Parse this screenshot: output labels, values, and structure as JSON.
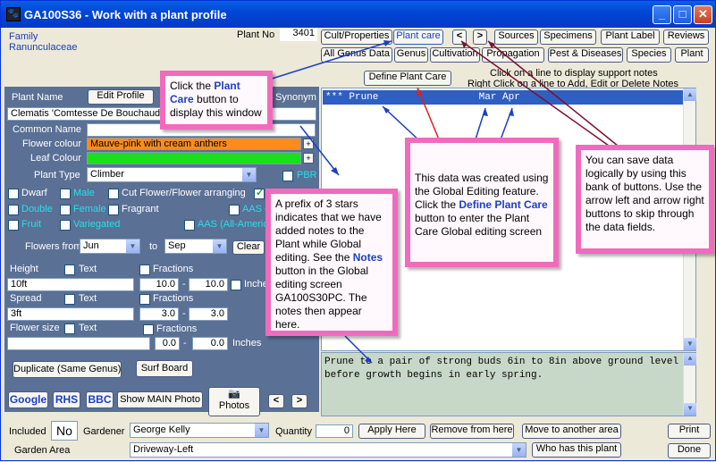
{
  "window": {
    "title": "GA100S36 - Work with a plant profile",
    "minimize": "_",
    "maximize": "□",
    "close": "✕",
    "app_icon": "🐾"
  },
  "header": {
    "family_label": "Family",
    "family_value": "Ranunculaceae",
    "plant_no_label": "Plant No",
    "plant_no_value": "3401"
  },
  "tabs_row1": [
    "Cult/Properties",
    "Plant care",
    "Sources",
    "Specimens",
    "Plant Label",
    "Reviews"
  ],
  "tabs_row2": [
    "All Genus Data",
    "Genus",
    "Cultivation",
    "Propagation",
    "Pest & Diseases",
    "Species",
    "Plant"
  ],
  "nav": {
    "left": "<",
    "right": ">"
  },
  "define_button": "Define Plant Care",
  "hints": {
    "line1": "Click on a line to display support notes",
    "line2": "Right Click on a line to Add, Edit or Delete Notes"
  },
  "notes": {
    "row_text": "*** Prune                 Mar Apr",
    "detail": "Prune to a pair of strong buds 6in to 8in above ground level before growth begins in early spring."
  },
  "form": {
    "plant_name_label": "Plant Name",
    "edit_profile": "Edit Profile",
    "synonym": "Synonym",
    "plant_name_value": "Clematis 'Comtesse De Bouchaud'",
    "common_name_label": "Common Name",
    "common_name_value": "",
    "flower_colour_label": "Flower colour",
    "flower_colour_value": "Mauve-pink with cream anthers",
    "leaf_colour_label": "Leaf Colour",
    "leaf_colour_value": "",
    "plant_type_label": "Plant Type",
    "plant_type_value": "Climber",
    "pbr": "PBR",
    "checks": [
      "Dwarf",
      "Male",
      "Cut Flower/Flower arranging",
      "A",
      "Double",
      "Female",
      "Fragrant",
      "AAS G",
      "Fruit",
      "Variegated",
      "AAS (All-America"
    ],
    "flowers_from_label": "Flowers from",
    "flowers_from_value": "Jun",
    "to_label": "to",
    "flowers_to_value": "Sep",
    "clear": "Clear",
    "height_label": "Height",
    "text_label": "Text",
    "fractions_label": "Fractions",
    "height_value": "10ft",
    "height_min": "10.0",
    "height_max": "10.0",
    "inches": "Inches",
    "spread_label": "Spread",
    "spread_value": "3ft",
    "spread_min": "3.0",
    "spread_max": "3.0",
    "flower_size_label": "Flower size",
    "flower_size_value": "",
    "fs_min": "0.0",
    "fs_max": "0.0",
    "dash": "-",
    "duplicate": "Duplicate (Same Genus)",
    "surf_board": "Surf Board",
    "google": "Google",
    "rhs": "RHS",
    "bbc": "BBC",
    "show_main_photo": "Show MAIN Photo",
    "photos": "Photos",
    "camera_icon": "📷"
  },
  "footer": {
    "included_label": "Included",
    "included_value": "No",
    "gardener_label": "Gardener",
    "gardener_value": "George Kelly",
    "quantity_label": "Quantity",
    "quantity_value": "0",
    "apply_here": "Apply Here",
    "remove_from_here": "Remove from here",
    "move_to_another_area": "Move to another area",
    "print": "Print",
    "garden_area_label": "Garden Area",
    "garden_area_value": "Driveway-Left",
    "who_has": "Who has this plant",
    "done": "Done"
  },
  "callouts": {
    "c1_pre": "Click the ",
    "c1_bold": "Plant Care",
    "c1_post": " button to display this window",
    "c2_pre": "A prefix of 3 stars indicates that we have added notes to the Plant while Global editing. See the ",
    "c2_bold": "Notes",
    "c2_post": " button in the Global editing screen GA100S30PC. The notes then appear here.",
    "c3_pre": "This data was created using the Global Editing feature. Click the ",
    "c3_bold": "Define Plant Care",
    "c3_post": " button to enter the Plant Care Global editing screen",
    "c4": "You can save data logically by using this bank of buttons. Use the arrow left and arrow right buttons to skip through the data fields."
  }
}
